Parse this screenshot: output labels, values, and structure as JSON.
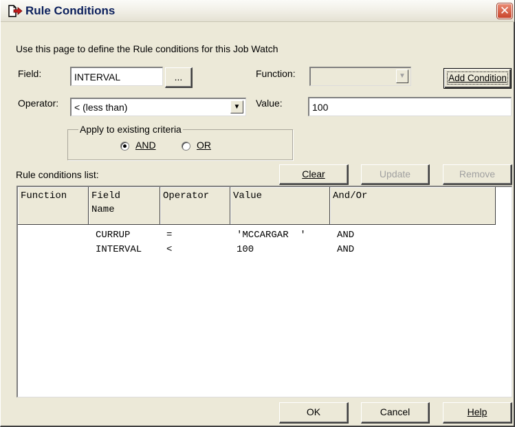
{
  "window": {
    "title": "Rule Conditions",
    "close_glyph": "✕"
  },
  "description": "Use this page to define the Rule conditions for this Job Watch",
  "field": {
    "label": "Field:",
    "value": "INTERVAL",
    "browse_label": "..."
  },
  "function": {
    "label": "Function:",
    "value": ""
  },
  "add_condition_label": "Add Condition",
  "operator": {
    "label": "Operator:",
    "value": "< (less than)"
  },
  "value_field": {
    "label": "Value:",
    "value": "100"
  },
  "apply_group": {
    "legend": "Apply to existing criteria",
    "and_label": "AND",
    "or_label": "OR",
    "selected": "AND"
  },
  "rule_list_label": "Rule conditions list:",
  "buttons": {
    "clear": "Clear",
    "update": "Update",
    "remove": "Remove",
    "ok": "OK",
    "cancel": "Cancel",
    "help": "Help"
  },
  "table": {
    "headers": [
      "Function",
      "Field\nName",
      "Operator",
      "Value",
      "And/Or"
    ],
    "rows": [
      {
        "function": "",
        "field": "CURRUP",
        "operator": "=",
        "value": "'MCCARGAR  '",
        "andor": "AND"
      },
      {
        "function": "",
        "field": "INTERVAL",
        "operator": "<",
        "value": "100",
        "andor": "AND"
      }
    ]
  },
  "icons": {
    "title": "rule-document-arrow-icon",
    "dropdown": "chevron-down-icon"
  }
}
